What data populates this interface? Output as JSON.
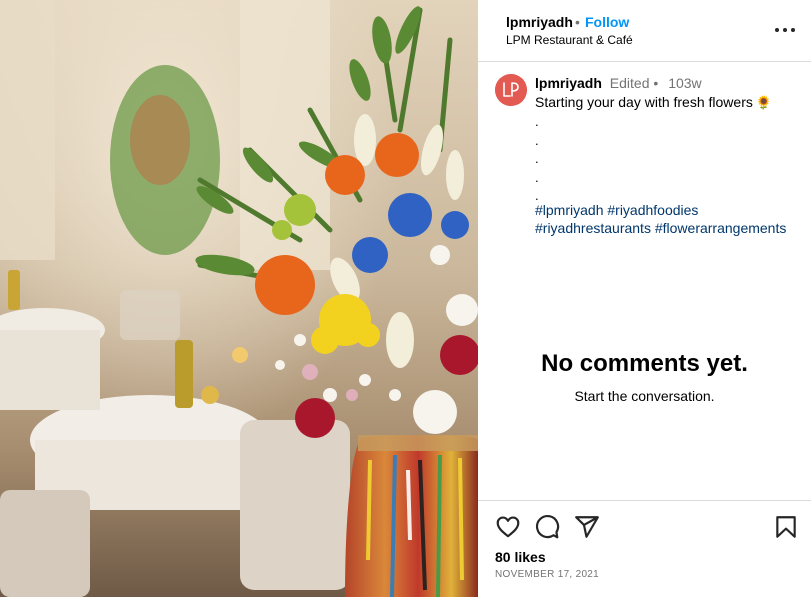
{
  "post": {
    "image_alt": "Vase of fresh flowers in restaurant",
    "header": {
      "username": "lpmriyadh",
      "separator": "•",
      "follow_label": "Follow",
      "location": "LPM Restaurant & Café",
      "more_icon": "more-options-icon"
    },
    "caption": {
      "username": "lpmriyadh",
      "edited": "Edited •",
      "time": "103w",
      "text": "Starting your day with fresh flowers",
      "emoji": "🌻",
      "dots": [
        ".",
        ".",
        ".",
        ".",
        "."
      ],
      "hashtags": [
        "#lpmriyadh",
        "#riyadhfoodies",
        "#riyadhrestaurants",
        "#flowerarrangements"
      ]
    },
    "comments": {
      "empty_title": "No comments yet.",
      "empty_subtitle": "Start the conversation."
    },
    "actions": {
      "icons": [
        "heart-icon",
        "comment-icon",
        "share-icon",
        "bookmark-icon"
      ],
      "likes": "80 likes",
      "date": "NOVEMBER 17, 2021"
    }
  },
  "colors": {
    "accent": "#0095f6",
    "hashtag": "#00376b",
    "secondary_text": "#737373",
    "border": "#dbdbdb",
    "avatar_bg": "#e25a52"
  }
}
